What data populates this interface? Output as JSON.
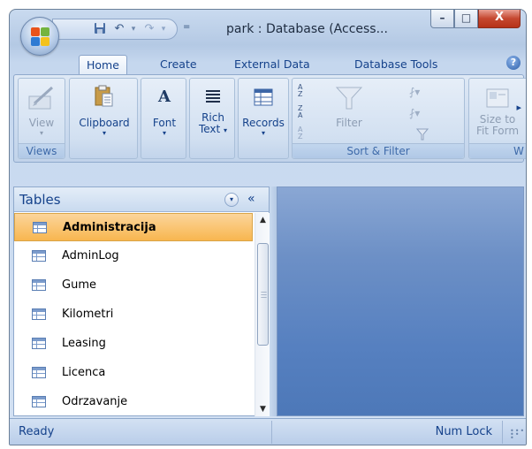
{
  "window": {
    "title": "park : Database (Access...",
    "controls": {
      "minimize": "–",
      "maximize": "□",
      "close": "X"
    }
  },
  "quick_access": {
    "save_icon": "save-icon",
    "undo_glyph": "↶",
    "redo_glyph": "↷",
    "dropdown_glyph": "▾",
    "customize_glyph": "="
  },
  "tabs": [
    {
      "label": "Home",
      "active": true
    },
    {
      "label": "Create",
      "active": false
    },
    {
      "label": "External Data",
      "active": false
    },
    {
      "label": "Database Tools",
      "active": false
    }
  ],
  "help_glyph": "?",
  "ribbon": {
    "views": {
      "group_label": "Views",
      "button": "View",
      "enabled": false
    },
    "clipboard": {
      "label": "Clipboard"
    },
    "font": {
      "label": "Font",
      "glyph": "A"
    },
    "rich_text": {
      "label_line1": "Rich",
      "label_line2": "Text"
    },
    "records": {
      "label": "Records"
    },
    "sort_filter": {
      "group_label": "Sort & Filter",
      "filter_label": "Filter"
    },
    "window": {
      "label_line1": "Size to",
      "label_line2": "Fit Form",
      "group_label_partial": "W"
    },
    "more_arrow": "▸",
    "dropdown": "▾"
  },
  "nav_pane": {
    "title": "Tables",
    "dropdown_glyph": "▾",
    "collapse_glyph": "«",
    "items": [
      {
        "label": "Administracija",
        "selected": true
      },
      {
        "label": "AdminLog",
        "selected": false
      },
      {
        "label": "Gume",
        "selected": false
      },
      {
        "label": "Kilometri",
        "selected": false
      },
      {
        "label": "Leasing",
        "selected": false
      },
      {
        "label": "Licenca",
        "selected": false
      },
      {
        "label": "Odrzavanje",
        "selected": false
      }
    ],
    "scroll_up": "▲",
    "scroll_down": "▼"
  },
  "status": {
    "left": "Ready",
    "right": "Num Lock"
  },
  "colors": {
    "selected_row": "#f8b64f",
    "workspace": "#5680c0",
    "ribbon_text": "#15428b"
  }
}
